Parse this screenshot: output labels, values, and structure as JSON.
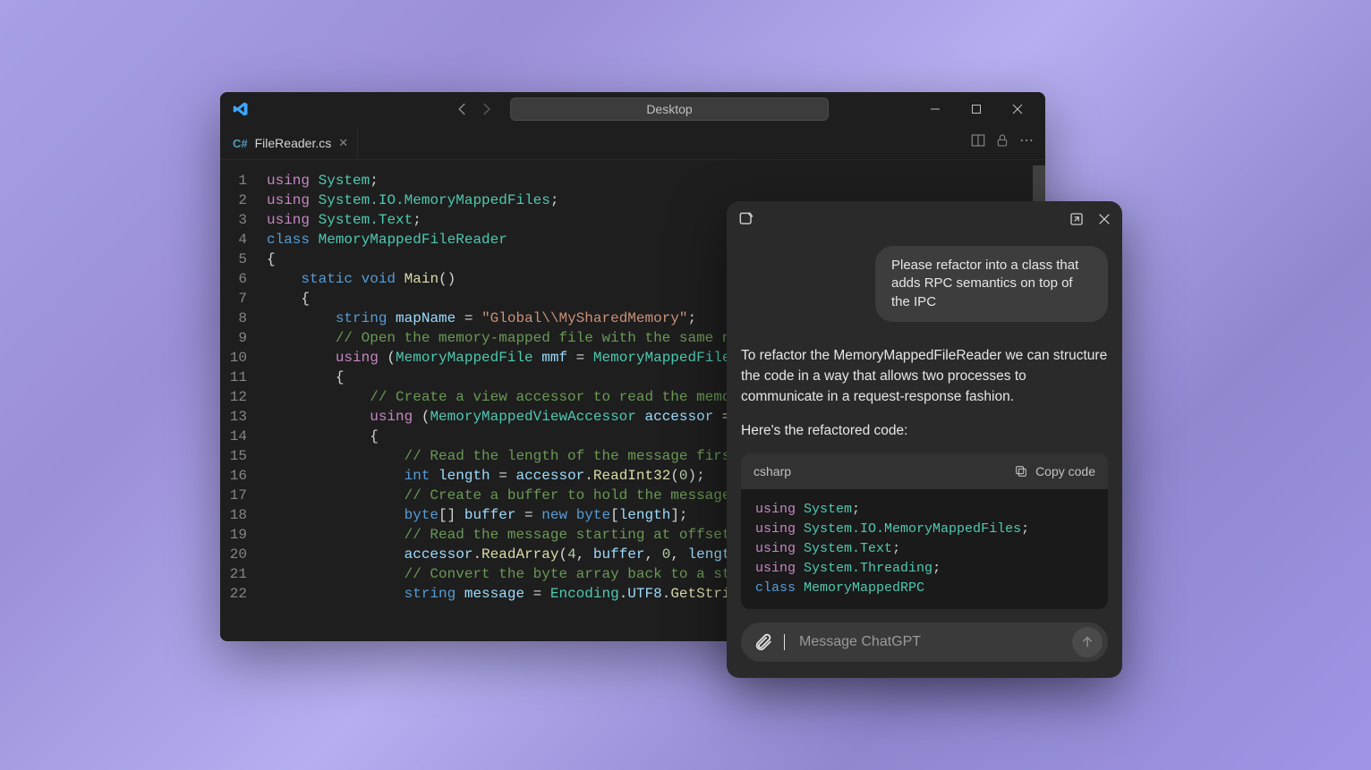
{
  "vscode": {
    "search_text": "Desktop",
    "tab": {
      "filename": "FileReader.cs"
    },
    "code_lines": [
      [
        [
          "kw",
          "using"
        ],
        [
          "punct",
          " "
        ],
        [
          "type",
          "System"
        ],
        [
          "punct",
          ";"
        ]
      ],
      [
        [
          "kw",
          "using"
        ],
        [
          "punct",
          " "
        ],
        [
          "type",
          "System.IO.MemoryMappedFiles"
        ],
        [
          "punct",
          ";"
        ]
      ],
      [
        [
          "kw",
          "using"
        ],
        [
          "punct",
          " "
        ],
        [
          "type",
          "System.Text"
        ],
        [
          "punct",
          ";"
        ]
      ],
      [
        [
          "kw2",
          "class"
        ],
        [
          "punct",
          " "
        ],
        [
          "type",
          "MemoryMappedFileReader"
        ]
      ],
      [
        [
          "punct",
          "{"
        ]
      ],
      [
        [
          "punct",
          "    "
        ],
        [
          "kw2",
          "static void"
        ],
        [
          "punct",
          " "
        ],
        [
          "fn",
          "Main"
        ],
        [
          "punct",
          "()"
        ]
      ],
      [
        [
          "punct",
          "    {"
        ]
      ],
      [
        [
          "punct",
          "        "
        ],
        [
          "kw2",
          "string"
        ],
        [
          "punct",
          " "
        ],
        [
          "ident",
          "mapName"
        ],
        [
          "punct",
          " = "
        ],
        [
          "str",
          "\"Global\\\\MySharedMemory\""
        ],
        [
          "punct",
          ";"
        ]
      ],
      [
        [
          "punct",
          "        "
        ],
        [
          "cmt",
          "// Open the memory-mapped file with the same na"
        ]
      ],
      [
        [
          "punct",
          "        "
        ],
        [
          "kw",
          "using"
        ],
        [
          "punct",
          " ("
        ],
        [
          "type",
          "MemoryMappedFile"
        ],
        [
          "punct",
          " "
        ],
        [
          "ident",
          "mmf"
        ],
        [
          "punct",
          " = "
        ],
        [
          "type",
          "MemoryMappedFile"
        ],
        [
          "punct",
          "."
        ]
      ],
      [
        [
          "punct",
          "        {"
        ]
      ],
      [
        [
          "punct",
          "            "
        ],
        [
          "cmt",
          "// Create a view accessor to read the memor"
        ]
      ],
      [
        [
          "punct",
          "            "
        ],
        [
          "kw",
          "using"
        ],
        [
          "punct",
          " ("
        ],
        [
          "type",
          "MemoryMappedViewAccessor"
        ],
        [
          "punct",
          " "
        ],
        [
          "ident",
          "accessor"
        ],
        [
          "punct",
          " = "
        ]
      ],
      [
        [
          "punct",
          "            {"
        ]
      ],
      [
        [
          "punct",
          "                "
        ],
        [
          "cmt",
          "// Read the length of the message first"
        ]
      ],
      [
        [
          "punct",
          "                "
        ],
        [
          "kw2",
          "int"
        ],
        [
          "punct",
          " "
        ],
        [
          "ident",
          "length"
        ],
        [
          "punct",
          " = "
        ],
        [
          "ident",
          "accessor"
        ],
        [
          "punct",
          "."
        ],
        [
          "fn",
          "ReadInt32"
        ],
        [
          "punct",
          "("
        ],
        [
          "num",
          "0"
        ],
        [
          "punct",
          ");"
        ]
      ],
      [
        [
          "punct",
          "                "
        ],
        [
          "cmt",
          "// Create a buffer to hold the message"
        ]
      ],
      [
        [
          "punct",
          "                "
        ],
        [
          "kw2",
          "byte"
        ],
        [
          "punct",
          "[] "
        ],
        [
          "ident",
          "buffer"
        ],
        [
          "punct",
          " = "
        ],
        [
          "kw2",
          "new"
        ],
        [
          "punct",
          " "
        ],
        [
          "kw2",
          "byte"
        ],
        [
          "punct",
          "["
        ],
        [
          "ident",
          "length"
        ],
        [
          "punct",
          "];"
        ]
      ],
      [
        [
          "punct",
          "                "
        ],
        [
          "cmt",
          "// Read the message starting at offset "
        ]
      ],
      [
        [
          "punct",
          "                "
        ],
        [
          "ident",
          "accessor"
        ],
        [
          "punct",
          "."
        ],
        [
          "fn",
          "ReadArray"
        ],
        [
          "punct",
          "("
        ],
        [
          "num",
          "4"
        ],
        [
          "punct",
          ", "
        ],
        [
          "ident",
          "buffer"
        ],
        [
          "punct",
          ", "
        ],
        [
          "num",
          "0"
        ],
        [
          "punct",
          ", "
        ],
        [
          "ident",
          "length"
        ]
      ],
      [
        [
          "punct",
          "                "
        ],
        [
          "cmt",
          "// Convert the byte array back to a str"
        ]
      ],
      [
        [
          "punct",
          "                "
        ],
        [
          "kw2",
          "string"
        ],
        [
          "punct",
          " "
        ],
        [
          "ident",
          "message"
        ],
        [
          "punct",
          " = "
        ],
        [
          "type",
          "Encoding"
        ],
        [
          "punct",
          "."
        ],
        [
          "ident",
          "UTF8"
        ],
        [
          "punct",
          "."
        ],
        [
          "fn",
          "GetStrin"
        ]
      ]
    ]
  },
  "chat": {
    "user_message": "Please refactor into a class that adds RPC semantics on top of the IPC",
    "assistant_para1": "To refactor the MemoryMappedFileReader we can structure the code in a way that allows two processes to communicate in a request-response fashion.",
    "assistant_para2": "Here's the refactored code:",
    "code_lang": "csharp",
    "copy_label": "Copy code",
    "code_lines": [
      [
        [
          "kw",
          "using"
        ],
        [
          "punct",
          " "
        ],
        [
          "type",
          "System"
        ],
        [
          "punct",
          ";"
        ]
      ],
      [
        [
          "kw",
          "using"
        ],
        [
          "punct",
          " "
        ],
        [
          "type",
          "System.IO.MemoryMappedFiles"
        ],
        [
          "punct",
          ";"
        ]
      ],
      [
        [
          "kw",
          "using"
        ],
        [
          "punct",
          " "
        ],
        [
          "type",
          "System.Text"
        ],
        [
          "punct",
          ";"
        ]
      ],
      [
        [
          "kw",
          "using"
        ],
        [
          "punct",
          " "
        ],
        [
          "type",
          "System.Threading"
        ],
        [
          "punct",
          ";"
        ]
      ],
      [
        [
          "punct",
          ""
        ]
      ],
      [
        [
          "kw2",
          "class"
        ],
        [
          "punct",
          " "
        ],
        [
          "type",
          "MemoryMappedRPC"
        ]
      ]
    ],
    "input_placeholder": "Message ChatGPT"
  }
}
